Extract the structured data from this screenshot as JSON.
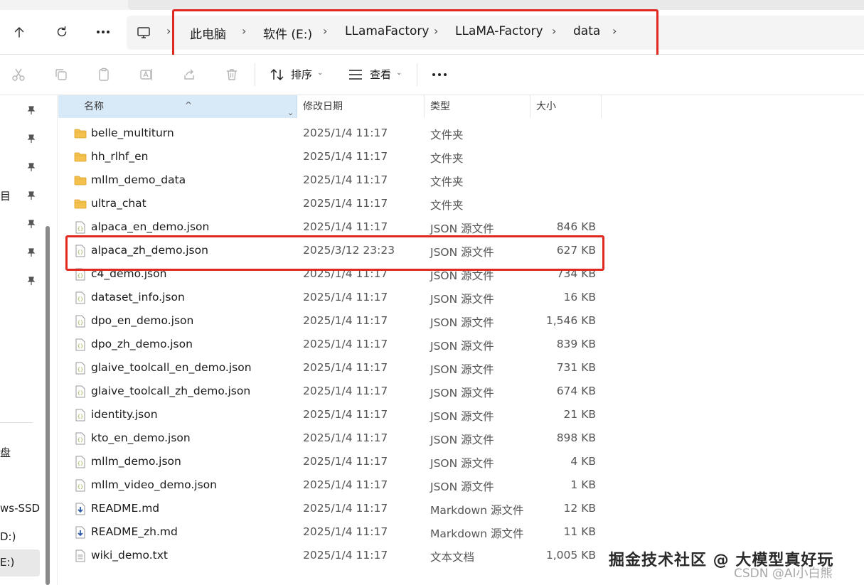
{
  "breadcrumb": [
    "此电脑",
    "软件 (E:)",
    "LLamaFactory",
    "LLaMA-Factory",
    "data"
  ],
  "toolbar": {
    "sort_label": "排序",
    "view_label": "查看",
    "more_label": "···"
  },
  "sidebar": {
    "items": [
      "目",
      "盘",
      "ws-SSD",
      "D:)",
      "E:)"
    ]
  },
  "columns": {
    "name": "名称",
    "date": "修改日期",
    "type": "类型",
    "size": "大小"
  },
  "files": [
    {
      "name": "belle_multiturn",
      "date": "2025/1/4 11:17",
      "type": "文件夹",
      "size": "",
      "icon": "folder-icon"
    },
    {
      "name": "hh_rlhf_en",
      "date": "2025/1/4 11:17",
      "type": "文件夹",
      "size": "",
      "icon": "folder-icon"
    },
    {
      "name": "mllm_demo_data",
      "date": "2025/1/4 11:17",
      "type": "文件夹",
      "size": "",
      "icon": "folder-icon"
    },
    {
      "name": "ultra_chat",
      "date": "2025/1/4 11:17",
      "type": "文件夹",
      "size": "",
      "icon": "folder-icon"
    },
    {
      "name": "alpaca_en_demo.json",
      "date": "2025/1/4 11:17",
      "type": "JSON 源文件",
      "size": "846 KB",
      "icon": "json-file-icon"
    },
    {
      "name": "alpaca_zh_demo.json",
      "date": "2025/3/12 23:23",
      "type": "JSON 源文件",
      "size": "627 KB",
      "icon": "json-file-icon"
    },
    {
      "name": "c4_demo.json",
      "date": "2025/1/4 11:17",
      "type": "JSON 源文件",
      "size": "734 KB",
      "icon": "json-file-icon"
    },
    {
      "name": "dataset_info.json",
      "date": "2025/1/4 11:17",
      "type": "JSON 源文件",
      "size": "16 KB",
      "icon": "json-file-icon"
    },
    {
      "name": "dpo_en_demo.json",
      "date": "2025/1/4 11:17",
      "type": "JSON 源文件",
      "size": "1,546 KB",
      "icon": "json-file-icon"
    },
    {
      "name": "dpo_zh_demo.json",
      "date": "2025/1/4 11:17",
      "type": "JSON 源文件",
      "size": "839 KB",
      "icon": "json-file-icon"
    },
    {
      "name": "glaive_toolcall_en_demo.json",
      "date": "2025/1/4 11:17",
      "type": "JSON 源文件",
      "size": "731 KB",
      "icon": "json-file-icon"
    },
    {
      "name": "glaive_toolcall_zh_demo.json",
      "date": "2025/1/4 11:17",
      "type": "JSON 源文件",
      "size": "674 KB",
      "icon": "json-file-icon"
    },
    {
      "name": "identity.json",
      "date": "2025/1/4 11:17",
      "type": "JSON 源文件",
      "size": "21 KB",
      "icon": "json-file-icon"
    },
    {
      "name": "kto_en_demo.json",
      "date": "2025/1/4 11:17",
      "type": "JSON 源文件",
      "size": "898 KB",
      "icon": "json-file-icon"
    },
    {
      "name": "mllm_demo.json",
      "date": "2025/1/4 11:17",
      "type": "JSON 源文件",
      "size": "4 KB",
      "icon": "json-file-icon"
    },
    {
      "name": "mllm_video_demo.json",
      "date": "2025/1/4 11:17",
      "type": "JSON 源文件",
      "size": "1 KB",
      "icon": "json-file-icon"
    },
    {
      "name": "README.md",
      "date": "2025/1/4 11:17",
      "type": "Markdown 源文件",
      "size": "12 KB",
      "icon": "markdown-file-icon"
    },
    {
      "name": "README_zh.md",
      "date": "2025/1/4 11:17",
      "type": "Markdown 源文件",
      "size": "11 KB",
      "icon": "markdown-file-icon"
    },
    {
      "name": "wiki_demo.txt",
      "date": "2025/1/4 11:17",
      "type": "文本文档",
      "size": "1,005 KB",
      "icon": "text-file-icon"
    }
  ],
  "watermark": {
    "line1": "掘金技术社区 @ 大模型真好玩",
    "line2": "CSDN @AI小白熊"
  },
  "colors": {
    "highlight": "#e0281f",
    "selected_header": "#d8e9f8",
    "folder": "#f4c04e",
    "json_icon": "#8aa83a",
    "md_icon": "#2c5aa8"
  }
}
